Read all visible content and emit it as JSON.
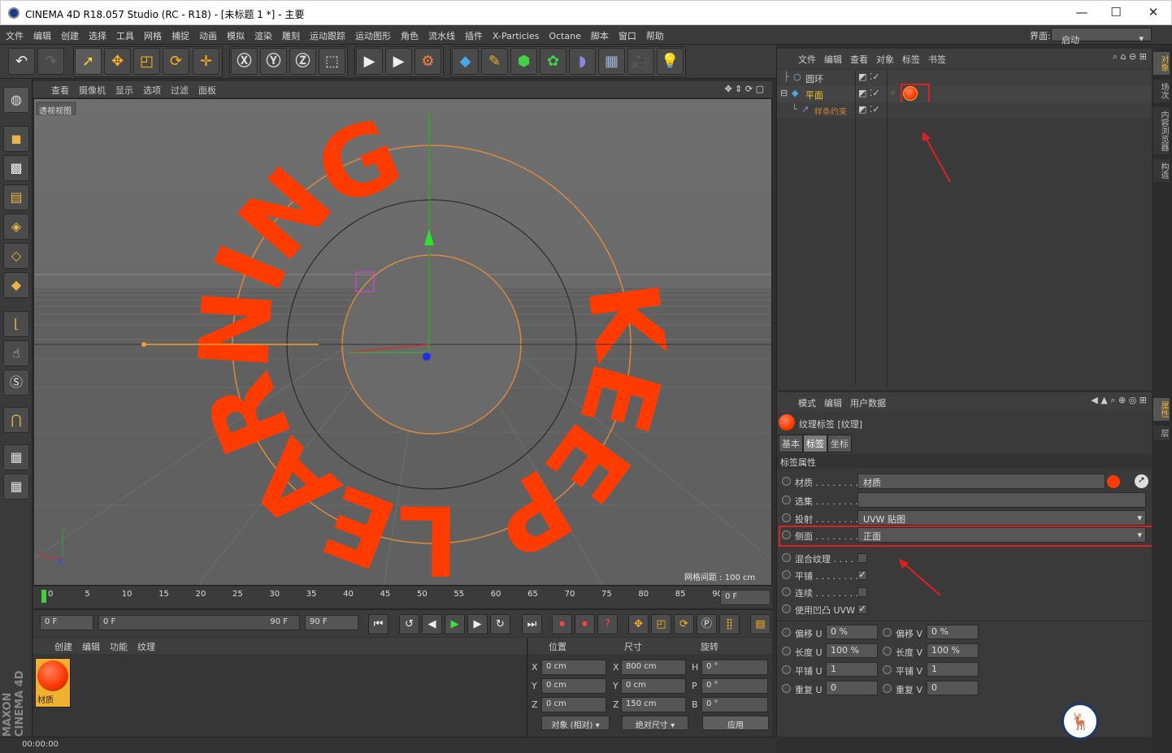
{
  "window": {
    "title": "CINEMA 4D R18.057 Studio (RC - R18) - [未标题 1 *] - 主要",
    "minimize": "—",
    "maximize": "☐",
    "close": "✕"
  },
  "menu": [
    "文件",
    "编辑",
    "创建",
    "选择",
    "工具",
    "网格",
    "捕捉",
    "动画",
    "模拟",
    "渲染",
    "雕刻",
    "运动跟踪",
    "运动图形",
    "角色",
    "流水线",
    "插件",
    "X-Particles",
    "Octane",
    "脚本",
    "窗口",
    "帮助"
  ],
  "layout": {
    "label": "界面:",
    "value": "启动"
  },
  "viewport": {
    "menu": [
      "查看",
      "摄像机",
      "显示",
      "选项",
      "过滤",
      "面板"
    ],
    "name": "透视视图",
    "grid_spacing": "网格间距 : 100 cm",
    "axis": {
      "y": "Y",
      "x": "X",
      "z": "Z"
    }
  },
  "timeline": {
    "ticks": [
      "0",
      "5",
      "10",
      "15",
      "20",
      "25",
      "30",
      "35",
      "40",
      "45",
      "50",
      "55",
      "60",
      "65",
      "70",
      "75",
      "80",
      "85",
      "90"
    ],
    "current": "0 F"
  },
  "playback": {
    "start": "0 F",
    "range_start": "0 F",
    "range_end": "90 F",
    "end": "90 F"
  },
  "material_panel": {
    "menu": [
      "创建",
      "编辑",
      "功能",
      "纹理"
    ],
    "material_name": "材质"
  },
  "coords": {
    "headers": [
      "位置",
      "尺寸",
      "旋转"
    ],
    "rows": [
      {
        "axis": "X",
        "pos": "0 cm",
        "size_axis": "X",
        "size": "800 cm",
        "rot_axis": "H",
        "rot": "0 °"
      },
      {
        "axis": "Y",
        "pos": "0 cm",
        "size_axis": "Y",
        "size": "0 cm",
        "rot_axis": "P",
        "rot": "0 °"
      },
      {
        "axis": "Z",
        "pos": "0 cm",
        "size_axis": "Z",
        "size": "150 cm",
        "rot_axis": "B",
        "rot": "0 °"
      }
    ],
    "mode": "对象 (相对)",
    "size_mode": "绝对尺寸",
    "apply": "应用"
  },
  "status": {
    "time": "00:00:00"
  },
  "objects": {
    "menu": [
      "文件",
      "编辑",
      "查看",
      "对象",
      "标签",
      "书签"
    ],
    "items": [
      {
        "name": "圆环",
        "color": "#d6d6d6"
      },
      {
        "name": "平面",
        "color": "#f2c230"
      },
      {
        "name": "样条约束",
        "color": "#c8833a"
      }
    ]
  },
  "attributes": {
    "menu": [
      "模式",
      "编辑",
      "用户数据"
    ],
    "title": "纹理标签 [纹理]",
    "tabs": [
      "基本",
      "标签",
      "坐标"
    ],
    "section": "标签属性",
    "fields": {
      "material_label": "材质 . . . . . . . .",
      "material_value": "材质",
      "selection_label": "选集 . . . . . . . .",
      "projection_label": "投射 . . . . . . . .",
      "projection_value": "UVW 贴图",
      "side_label": "侧面 . . . . . . . .",
      "side_value": "正面",
      "mix_label": "混合纹理 . . . . .",
      "tile_label": "平铺 . . . . . . . .",
      "seamless_label": "连续 . . . . . . . .",
      "bump_label": "使用凹凸 UVW",
      "offset_u_label": "偏移 U",
      "offset_u": "0 %",
      "offset_v_label": "偏移 V",
      "offset_v": "0 %",
      "length_u_label": "长度 U",
      "length_u": "100 %",
      "length_v_label": "长度 V",
      "length_v": "100 %",
      "tiles_u_label": "平铺 U",
      "tiles_u": "1",
      "tiles_v_label": "平铺 V",
      "tiles_v": "1",
      "repeat_u_label": "重复 U",
      "repeat_u": "0",
      "repeat_v_label": "重复 V",
      "repeat_v": "0"
    }
  },
  "side_tabs": [
    "对象",
    "场次",
    "内容浏览器",
    "构造"
  ],
  "side_tabs_attr": [
    "属性",
    "层"
  ],
  "viewport_text": "KEEP LEARNING",
  "brand": "MAXON CINEMA 4D",
  "accent_color": "#ff3b00"
}
